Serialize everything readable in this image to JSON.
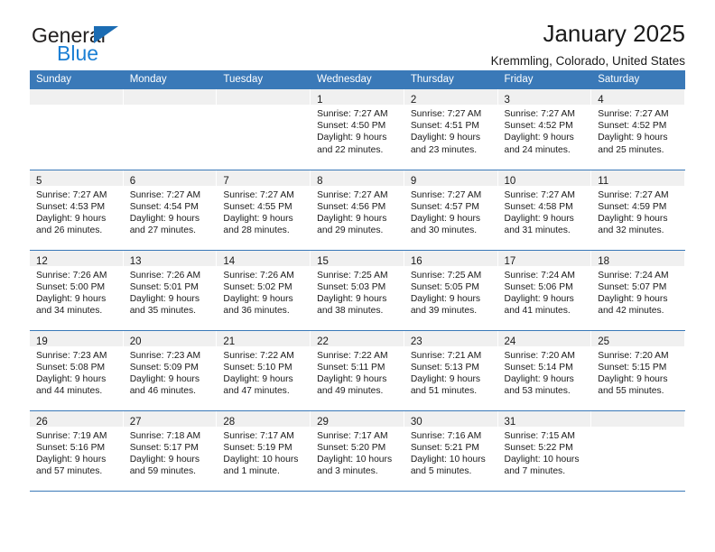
{
  "brand": {
    "name_part1": "General",
    "name_part2": "Blue",
    "accent_color": "#1b7fd4",
    "triangle_color": "#1b6cb3"
  },
  "header": {
    "title": "January 2025",
    "subtitle": "Kremmling, Colorado, United States"
  },
  "theme": {
    "header_row_color": "#3a79b8",
    "day_band_color": "#f0f0f0",
    "border_color": "#3a79b8"
  },
  "weekdays": [
    "Sunday",
    "Monday",
    "Tuesday",
    "Wednesday",
    "Thursday",
    "Friday",
    "Saturday"
  ],
  "weeks": [
    [
      {
        "day": "",
        "sunrise": "",
        "sunset": "",
        "daylight_line1": "",
        "daylight_line2": ""
      },
      {
        "day": "",
        "sunrise": "",
        "sunset": "",
        "daylight_line1": "",
        "daylight_line2": ""
      },
      {
        "day": "",
        "sunrise": "",
        "sunset": "",
        "daylight_line1": "",
        "daylight_line2": ""
      },
      {
        "day": "1",
        "sunrise": "Sunrise: 7:27 AM",
        "sunset": "Sunset: 4:50 PM",
        "daylight_line1": "Daylight: 9 hours",
        "daylight_line2": "and 22 minutes."
      },
      {
        "day": "2",
        "sunrise": "Sunrise: 7:27 AM",
        "sunset": "Sunset: 4:51 PM",
        "daylight_line1": "Daylight: 9 hours",
        "daylight_line2": "and 23 minutes."
      },
      {
        "day": "3",
        "sunrise": "Sunrise: 7:27 AM",
        "sunset": "Sunset: 4:52 PM",
        "daylight_line1": "Daylight: 9 hours",
        "daylight_line2": "and 24 minutes."
      },
      {
        "day": "4",
        "sunrise": "Sunrise: 7:27 AM",
        "sunset": "Sunset: 4:52 PM",
        "daylight_line1": "Daylight: 9 hours",
        "daylight_line2": "and 25 minutes."
      }
    ],
    [
      {
        "day": "5",
        "sunrise": "Sunrise: 7:27 AM",
        "sunset": "Sunset: 4:53 PM",
        "daylight_line1": "Daylight: 9 hours",
        "daylight_line2": "and 26 minutes."
      },
      {
        "day": "6",
        "sunrise": "Sunrise: 7:27 AM",
        "sunset": "Sunset: 4:54 PM",
        "daylight_line1": "Daylight: 9 hours",
        "daylight_line2": "and 27 minutes."
      },
      {
        "day": "7",
        "sunrise": "Sunrise: 7:27 AM",
        "sunset": "Sunset: 4:55 PM",
        "daylight_line1": "Daylight: 9 hours",
        "daylight_line2": "and 28 minutes."
      },
      {
        "day": "8",
        "sunrise": "Sunrise: 7:27 AM",
        "sunset": "Sunset: 4:56 PM",
        "daylight_line1": "Daylight: 9 hours",
        "daylight_line2": "and 29 minutes."
      },
      {
        "day": "9",
        "sunrise": "Sunrise: 7:27 AM",
        "sunset": "Sunset: 4:57 PM",
        "daylight_line1": "Daylight: 9 hours",
        "daylight_line2": "and 30 minutes."
      },
      {
        "day": "10",
        "sunrise": "Sunrise: 7:27 AM",
        "sunset": "Sunset: 4:58 PM",
        "daylight_line1": "Daylight: 9 hours",
        "daylight_line2": "and 31 minutes."
      },
      {
        "day": "11",
        "sunrise": "Sunrise: 7:27 AM",
        "sunset": "Sunset: 4:59 PM",
        "daylight_line1": "Daylight: 9 hours",
        "daylight_line2": "and 32 minutes."
      }
    ],
    [
      {
        "day": "12",
        "sunrise": "Sunrise: 7:26 AM",
        "sunset": "Sunset: 5:00 PM",
        "daylight_line1": "Daylight: 9 hours",
        "daylight_line2": "and 34 minutes."
      },
      {
        "day": "13",
        "sunrise": "Sunrise: 7:26 AM",
        "sunset": "Sunset: 5:01 PM",
        "daylight_line1": "Daylight: 9 hours",
        "daylight_line2": "and 35 minutes."
      },
      {
        "day": "14",
        "sunrise": "Sunrise: 7:26 AM",
        "sunset": "Sunset: 5:02 PM",
        "daylight_line1": "Daylight: 9 hours",
        "daylight_line2": "and 36 minutes."
      },
      {
        "day": "15",
        "sunrise": "Sunrise: 7:25 AM",
        "sunset": "Sunset: 5:03 PM",
        "daylight_line1": "Daylight: 9 hours",
        "daylight_line2": "and 38 minutes."
      },
      {
        "day": "16",
        "sunrise": "Sunrise: 7:25 AM",
        "sunset": "Sunset: 5:05 PM",
        "daylight_line1": "Daylight: 9 hours",
        "daylight_line2": "and 39 minutes."
      },
      {
        "day": "17",
        "sunrise": "Sunrise: 7:24 AM",
        "sunset": "Sunset: 5:06 PM",
        "daylight_line1": "Daylight: 9 hours",
        "daylight_line2": "and 41 minutes."
      },
      {
        "day": "18",
        "sunrise": "Sunrise: 7:24 AM",
        "sunset": "Sunset: 5:07 PM",
        "daylight_line1": "Daylight: 9 hours",
        "daylight_line2": "and 42 minutes."
      }
    ],
    [
      {
        "day": "19",
        "sunrise": "Sunrise: 7:23 AM",
        "sunset": "Sunset: 5:08 PM",
        "daylight_line1": "Daylight: 9 hours",
        "daylight_line2": "and 44 minutes."
      },
      {
        "day": "20",
        "sunrise": "Sunrise: 7:23 AM",
        "sunset": "Sunset: 5:09 PM",
        "daylight_line1": "Daylight: 9 hours",
        "daylight_line2": "and 46 minutes."
      },
      {
        "day": "21",
        "sunrise": "Sunrise: 7:22 AM",
        "sunset": "Sunset: 5:10 PM",
        "daylight_line1": "Daylight: 9 hours",
        "daylight_line2": "and 47 minutes."
      },
      {
        "day": "22",
        "sunrise": "Sunrise: 7:22 AM",
        "sunset": "Sunset: 5:11 PM",
        "daylight_line1": "Daylight: 9 hours",
        "daylight_line2": "and 49 minutes."
      },
      {
        "day": "23",
        "sunrise": "Sunrise: 7:21 AM",
        "sunset": "Sunset: 5:13 PM",
        "daylight_line1": "Daylight: 9 hours",
        "daylight_line2": "and 51 minutes."
      },
      {
        "day": "24",
        "sunrise": "Sunrise: 7:20 AM",
        "sunset": "Sunset: 5:14 PM",
        "daylight_line1": "Daylight: 9 hours",
        "daylight_line2": "and 53 minutes."
      },
      {
        "day": "25",
        "sunrise": "Sunrise: 7:20 AM",
        "sunset": "Sunset: 5:15 PM",
        "daylight_line1": "Daylight: 9 hours",
        "daylight_line2": "and 55 minutes."
      }
    ],
    [
      {
        "day": "26",
        "sunrise": "Sunrise: 7:19 AM",
        "sunset": "Sunset: 5:16 PM",
        "daylight_line1": "Daylight: 9 hours",
        "daylight_line2": "and 57 minutes."
      },
      {
        "day": "27",
        "sunrise": "Sunrise: 7:18 AM",
        "sunset": "Sunset: 5:17 PM",
        "daylight_line1": "Daylight: 9 hours",
        "daylight_line2": "and 59 minutes."
      },
      {
        "day": "28",
        "sunrise": "Sunrise: 7:17 AM",
        "sunset": "Sunset: 5:19 PM",
        "daylight_line1": "Daylight: 10 hours",
        "daylight_line2": "and 1 minute."
      },
      {
        "day": "29",
        "sunrise": "Sunrise: 7:17 AM",
        "sunset": "Sunset: 5:20 PM",
        "daylight_line1": "Daylight: 10 hours",
        "daylight_line2": "and 3 minutes."
      },
      {
        "day": "30",
        "sunrise": "Sunrise: 7:16 AM",
        "sunset": "Sunset: 5:21 PM",
        "daylight_line1": "Daylight: 10 hours",
        "daylight_line2": "and 5 minutes."
      },
      {
        "day": "31",
        "sunrise": "Sunrise: 7:15 AM",
        "sunset": "Sunset: 5:22 PM",
        "daylight_line1": "Daylight: 10 hours",
        "daylight_line2": "and 7 minutes."
      },
      {
        "day": "",
        "sunrise": "",
        "sunset": "",
        "daylight_line1": "",
        "daylight_line2": ""
      }
    ]
  ]
}
